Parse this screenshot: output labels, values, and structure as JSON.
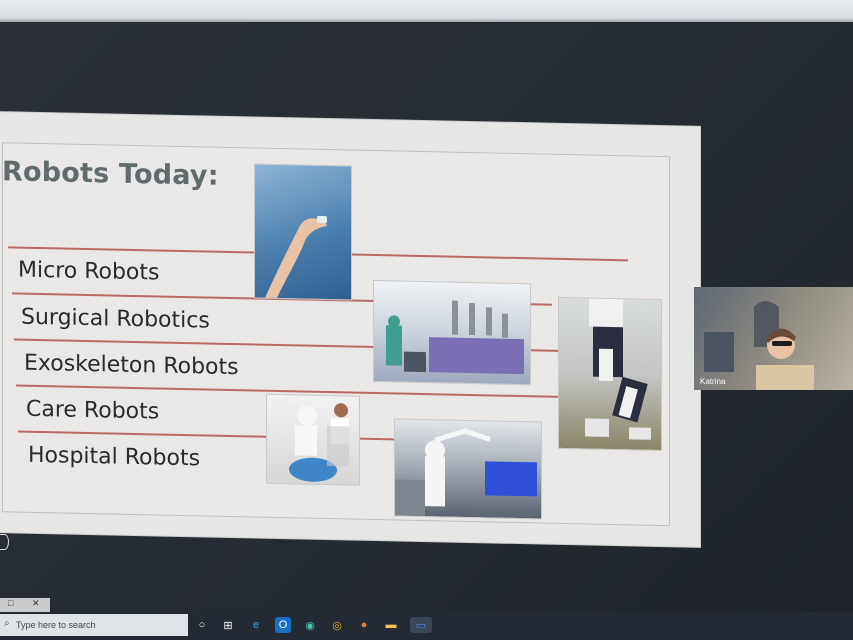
{
  "slide": {
    "title": "Robots Today:",
    "items": [
      {
        "label": "Micro Robots"
      },
      {
        "label": "Surgical Robotics"
      },
      {
        "label": "Exoskeleton Robots"
      },
      {
        "label": "Care Robots"
      },
      {
        "label": "Hospital Robots"
      }
    ],
    "photos": [
      "micro-robot-photo",
      "surgical-robot-photo",
      "exoskeleton-photo",
      "care-robot-photo",
      "hospital-robot-photo"
    ],
    "rule_color": "#b86b66",
    "title_color": "#5f6b6d"
  },
  "video": {
    "participant_name": "Katrina"
  },
  "taskbar": {
    "search_placeholder": "Type here to search",
    "icons": [
      "search-icon",
      "cortana-circle-icon",
      "task-view-icon",
      "edge-icon",
      "outlook-icon",
      "edge-dev-icon",
      "chrome-icon",
      "firefox-icon",
      "file-explorer-icon",
      "zoom-icon"
    ]
  },
  "mini_window": {
    "restore_glyph": "□",
    "close_glyph": "✕"
  }
}
